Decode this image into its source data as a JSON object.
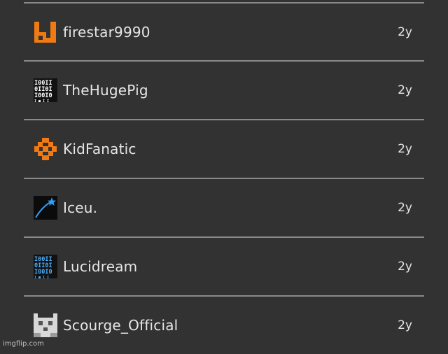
{
  "entries": [
    {
      "username": "firestar9990",
      "time": "2y",
      "avatar_icon": "orange-block-logo-icon",
      "accent": "#f07a13"
    },
    {
      "username": "TheHugePig",
      "time": "2y",
      "avatar_icon": "binary-code-avatar-icon",
      "accent": "#ffffff"
    },
    {
      "username": "KidFanatic",
      "time": "2y",
      "avatar_icon": "orange-pixel-diamond-icon",
      "accent": "#f07a13"
    },
    {
      "username": "Iceu.",
      "time": "2y",
      "avatar_icon": "shooting-star-avatar-icon",
      "accent": "#2f9fff"
    },
    {
      "username": "Lucidream",
      "time": "2y",
      "avatar_icon": "blue-binary-code-avatar-icon",
      "accent": "#4ab0ff"
    },
    {
      "username": "Scourge_Official",
      "time": "2y",
      "avatar_icon": "pixel-cat-face-icon",
      "accent": "#d8d8d8"
    }
  ],
  "watermark": "imgflip.com"
}
